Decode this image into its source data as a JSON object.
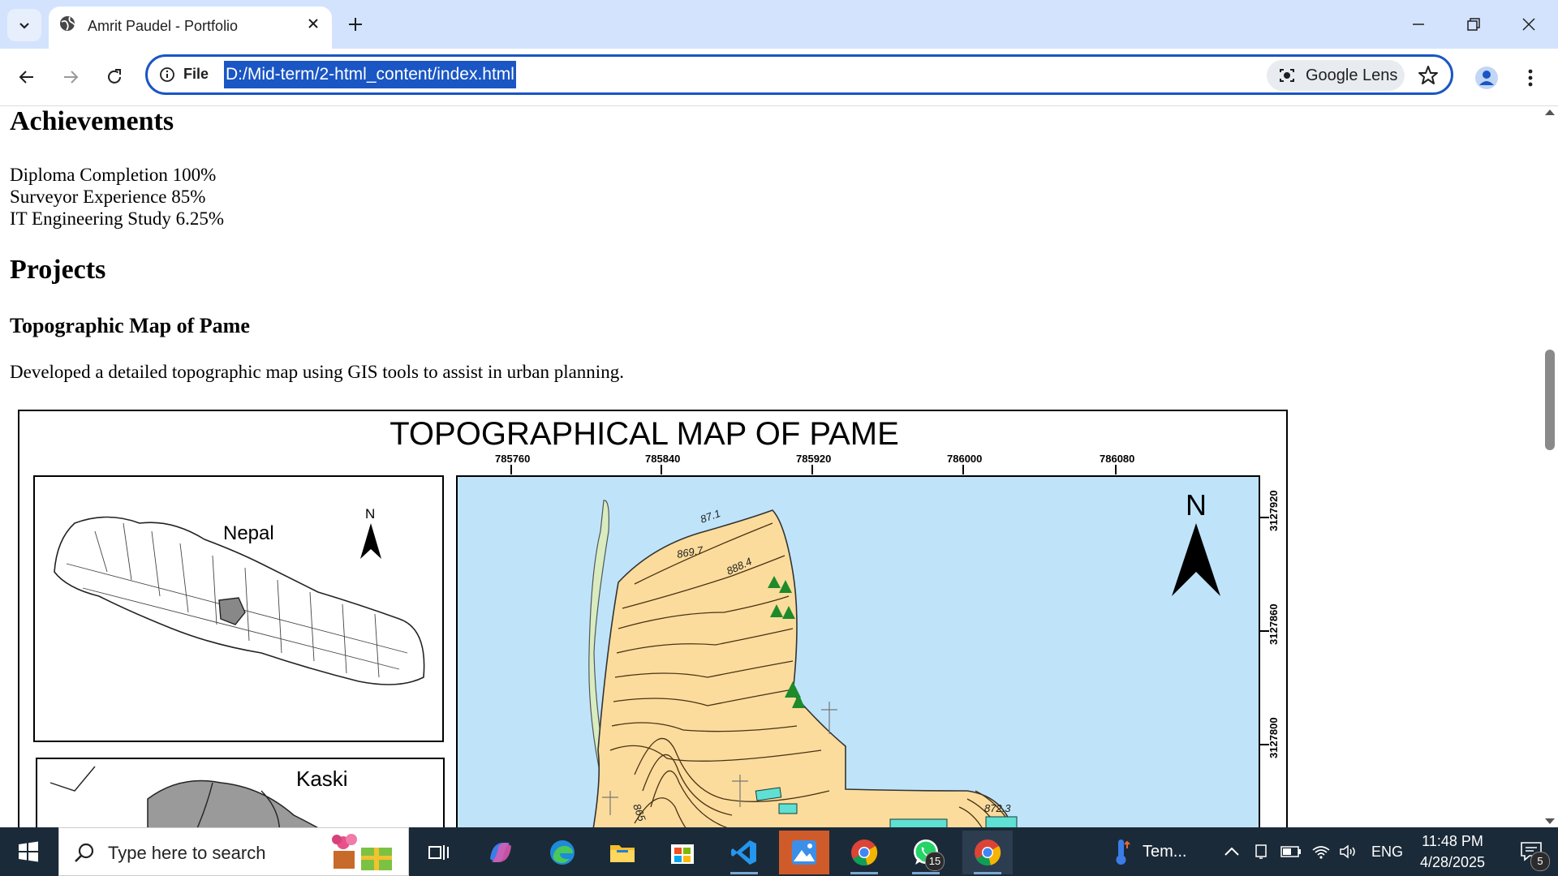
{
  "browser": {
    "tab_title": "Amrit Paudel - Portfolio",
    "url_scheme_label": "File",
    "url": "D:/Mid-term/2-html_content/index.html",
    "lens_label": "Google Lens"
  },
  "page": {
    "achievements_heading": "Achievements",
    "achievements": [
      "Diploma Completion 100%",
      "Surveyor Experience 85%",
      "IT Engineering Study 6.25%"
    ],
    "projects_heading": "Projects",
    "project_title": "Topographic Map of Pame",
    "project_description": "Developed a detailed topographic map using GIS tools to assist in urban planning.",
    "map": {
      "title": "TOPOGRAPHICAL MAP OF PAME",
      "x_ticks": [
        "785760",
        "785840",
        "785920",
        "786000",
        "786080"
      ],
      "y_ticks": [
        "3127920",
        "3127860",
        "3127800"
      ],
      "inset1_label": "Nepal",
      "inset2_label": "Kaski",
      "north_label": "N",
      "contour_labels": [
        "87.1",
        "869.7",
        "888.4",
        "872.3",
        "865"
      ]
    }
  },
  "taskbar": {
    "search_placeholder": "Type here to search",
    "weather_label": "Tem...",
    "language": "ENG",
    "time": "11:48 PM",
    "date": "4/28/2025",
    "whatsapp_badge": "15",
    "notification_badge": "5"
  }
}
